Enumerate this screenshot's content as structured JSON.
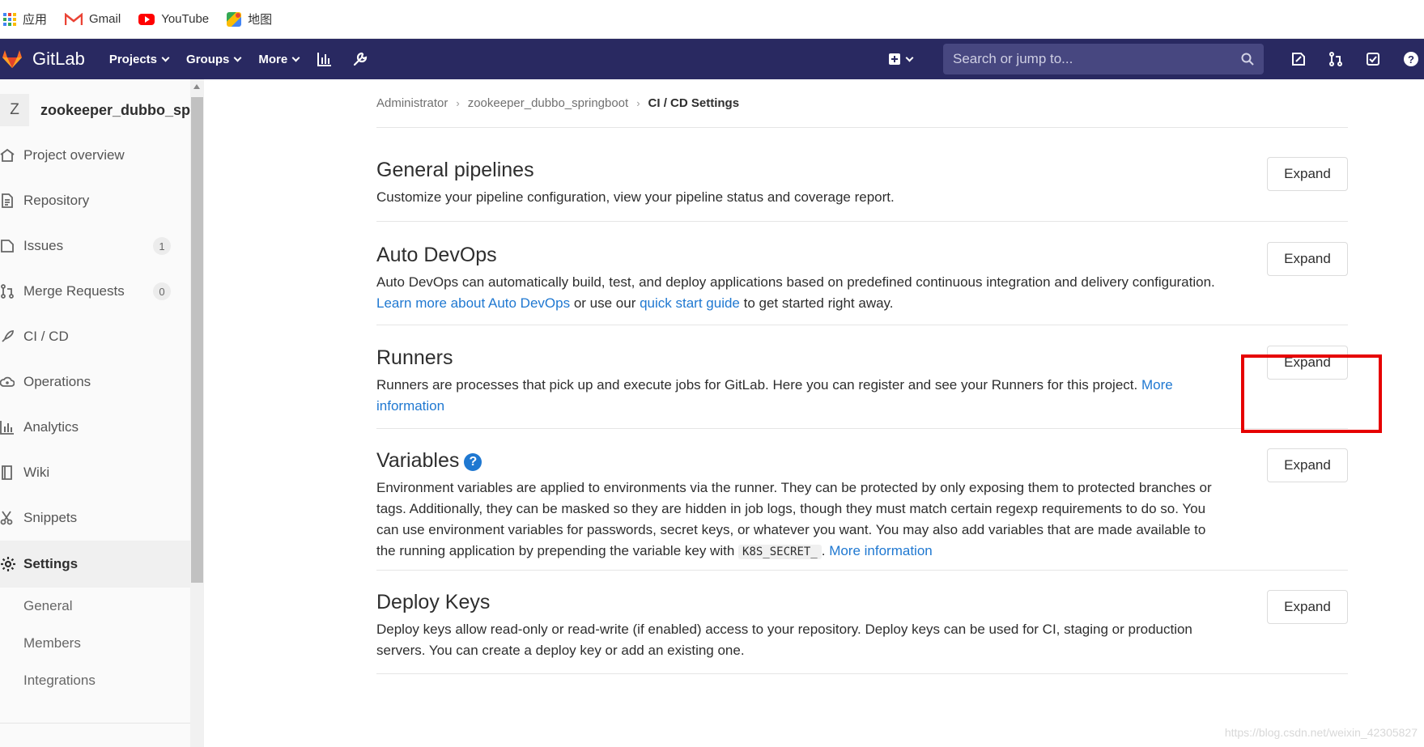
{
  "bookmarks": [
    {
      "label": "应用",
      "icon": "apps-grid-icon"
    },
    {
      "label": "Gmail",
      "icon": "gmail-icon"
    },
    {
      "label": "YouTube",
      "icon": "youtube-icon"
    },
    {
      "label": "地图",
      "icon": "maps-icon"
    }
  ],
  "navbar": {
    "brand": "GitLab",
    "menu": [
      "Projects",
      "Groups",
      "More"
    ],
    "search_placeholder": "Search or jump to...",
    "bg_color": "#292961"
  },
  "sidebar": {
    "avatar_letter": "Z",
    "project_name": "zookeeper_dubbo_sp...",
    "items": [
      {
        "label": "Project overview",
        "icon": "home-icon"
      },
      {
        "label": "Repository",
        "icon": "document-icon"
      },
      {
        "label": "Issues",
        "icon": "issues-icon",
        "badge": "1"
      },
      {
        "label": "Merge Requests",
        "icon": "merge-request-icon",
        "badge": "0"
      },
      {
        "label": "CI / CD",
        "icon": "rocket-icon"
      },
      {
        "label": "Operations",
        "icon": "cloud-gear-icon"
      },
      {
        "label": "Analytics",
        "icon": "bar-chart-icon"
      },
      {
        "label": "Wiki",
        "icon": "book-icon"
      },
      {
        "label": "Snippets",
        "icon": "scissors-icon"
      },
      {
        "label": "Settings",
        "icon": "gear-icon"
      }
    ],
    "settings_sub": [
      "General",
      "Members",
      "Integrations"
    ]
  },
  "breadcrumb": [
    "Administrator",
    "zookeeper_dubbo_springboot",
    "CI / CD Settings"
  ],
  "expand_label": "Expand",
  "sections": {
    "general": {
      "title": "General pipelines",
      "desc": "Customize your pipeline configuration, view your pipeline status and coverage report."
    },
    "autodevops": {
      "title": "Auto DevOps",
      "desc1": "Auto DevOps can automatically build, test, and deploy applications based on predefined continuous integration and delivery configuration. ",
      "link1": "Learn more about Auto DevOps",
      "desc2": " or use our ",
      "link2": "quick start guide",
      "desc3": " to get started right away."
    },
    "runners": {
      "title": "Runners",
      "desc": "Runners are processes that pick up and execute jobs for GitLab. Here you can register and see your Runners for this project. ",
      "link": "More information"
    },
    "variables": {
      "title": "Variables",
      "help": "?",
      "desc": "Environment variables are applied to environments via the runner. They can be protected by only exposing them to protected branches or tags. Additionally, they can be masked so they are hidden in job logs, though they must match certain regexp requirements to do so. You can use environment variables for passwords, secret keys, or whatever you want. You may also add variables that are made available to the running application by prepending the variable key with ",
      "code": "K8S_SECRET_",
      "after": ". ",
      "link": "More information"
    },
    "deploykeys": {
      "title": "Deploy Keys",
      "desc": "Deploy keys allow read-only or read-write (if enabled) access to your repository. Deploy keys can be used for CI, staging or production servers. You can create a deploy key or add an existing one."
    }
  },
  "watermark": "https://blog.csdn.net/weixin_42305827",
  "colors": {
    "link": "#1f78d1",
    "highlight": "#e60000"
  }
}
